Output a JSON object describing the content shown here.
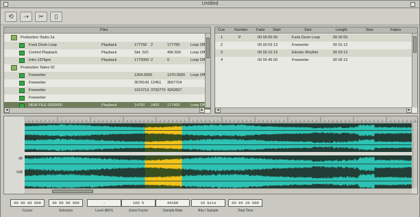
{
  "window": {
    "title": "Untitled"
  },
  "toolbar": {
    "buttons": [
      "tool-1",
      "tool-2",
      "tool-3",
      "tool-4"
    ]
  },
  "files_panel": {
    "header": "Files",
    "rows": [
      {
        "name": "Production Stubs 2a",
        "type": "",
        "size": "",
        "chan": "",
        "sr": "",
        "bits": ""
      },
      {
        "name": "Funk Drum Loop",
        "type": "Playback",
        "size": "177750",
        "chan": "2",
        "sr": "177750",
        "bits": "Loop Off"
      },
      {
        "name": "Control Playback",
        "type": "Playback",
        "size": "Std. S/O",
        "chan": "",
        "sr": "496.500",
        "bits": "Loop Off"
      },
      {
        "name": "Intro 137bpm",
        "type": "Playback",
        "size": "1772000",
        "chan": "2",
        "sr": "0",
        "bits": "Loop Off"
      },
      {
        "name": "Production Takes 02",
        "type": "",
        "size": "",
        "chan": "",
        "sr": "",
        "bits": ""
      },
      {
        "name": "Freewriter",
        "type": "",
        "size": "1304.0000",
        "chan": "",
        "sr": "1370.0000",
        "bits": "Loop Off"
      },
      {
        "name": "Freewriter",
        "type": "",
        "size": "3678143",
        "chan": "12451",
        "sr": "3567704",
        "bits": ""
      },
      {
        "name": "Freewriter",
        "type": "",
        "size": "1013713",
        "chan": "3793770",
        "sr": "4262657",
        "bits": ""
      },
      {
        "name": "Freewriter",
        "type": "",
        "size": "",
        "chan": "",
        "sr": "",
        "bits": ""
      },
      {
        "name": "NEW FILE 0000000",
        "type": "Playback",
        "size": "14750",
        "chan": "2403",
        "sr": "177469",
        "bits": "Loop Off"
      }
    ]
  },
  "regions_panel": {
    "columns": [
      "Cue",
      "Number",
      "Fade",
      "Start",
      "Size",
      "Length",
      "Size",
      "Fades"
    ],
    "rows": [
      {
        "num": "1",
        "fade": "P",
        "start": "00 00 00 00",
        "name": "Funk Drum Loop",
        "length": "00 00 00"
      },
      {
        "num": "2",
        "fade": "",
        "start": "00 00 03 13",
        "name": "Freewriter",
        "length": "00 01 12"
      },
      {
        "num": "3",
        "fade": "",
        "start": "00 00 10 13",
        "name": "Electric Rhythm",
        "length": "00 03 12"
      },
      {
        "num": "4",
        "fade": "",
        "start": "00 00 45 00",
        "name": "Freewriter",
        "length": "00 06 12"
      }
    ]
  },
  "waveform": {
    "ruler_ticks": [
      "",
      "",
      "",
      "",
      "",
      "",
      "",
      "",
      "",
      "",
      ""
    ],
    "scale_top": [
      "",
      "",
      ""
    ],
    "scale_bottom": [
      "dB",
      "",
      "0dB",
      "",
      ""
    ],
    "selection": {
      "start_fraction": 0.31,
      "end_fraction": 0.405
    },
    "colors": {
      "wave": "#2dc2b3",
      "selection": "#f2c21b",
      "background": "#213d35"
    }
  },
  "status": {
    "fields": [
      {
        "value": "00 00 00 000",
        "label": "Cursor"
      },
      {
        "value": "00 00 00 000",
        "label": "Selection"
      },
      {
        "value": "-",
        "label": "Level dBFS"
      },
      {
        "value": "100 %",
        "label": "Zoom Factor"
      },
      {
        "value": "44100",
        "label": "Sample Rate"
      },
      {
        "value": "16 bits",
        "label": "Bits / Sample"
      },
      {
        "value": "00 04 20 000",
        "label": "Total Time"
      }
    ]
  }
}
